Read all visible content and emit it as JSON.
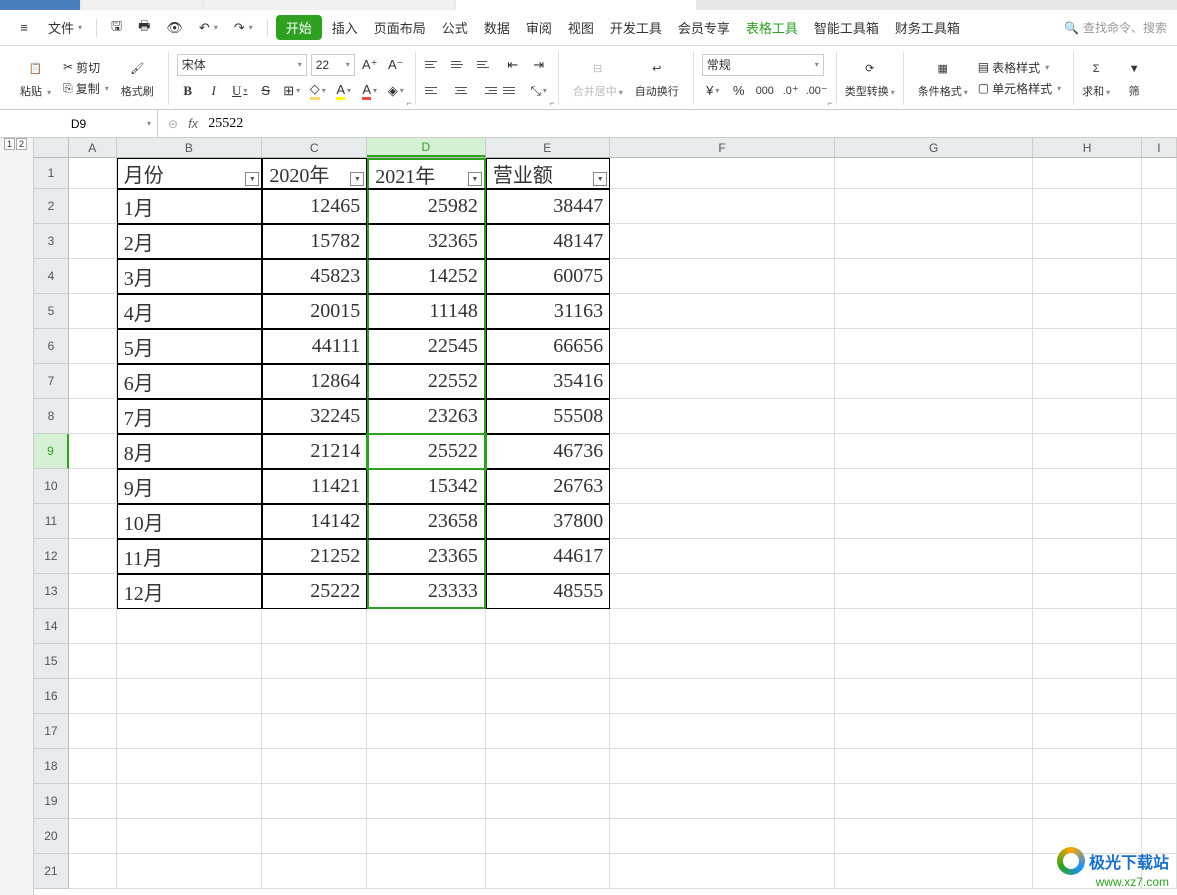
{
  "menu": {
    "file": "文件",
    "items": [
      "开始",
      "插入",
      "页面布局",
      "公式",
      "数据",
      "审阅",
      "视图",
      "开发工具",
      "会员专享",
      "表格工具",
      "智能工具箱",
      "财务工具箱"
    ],
    "search_placeholder": "查找命令、搜索"
  },
  "ribbon": {
    "paste": "粘贴",
    "cut": "剪切",
    "copy": "复制",
    "format_painter": "格式刷",
    "font_name": "宋体",
    "font_size": "22",
    "merge_center": "合并居中",
    "wrap_text": "自动换行",
    "number_format": "常规",
    "type_convert": "类型转换",
    "cond_format": "条件格式",
    "table_style": "表格样式",
    "cell_style": "单元格样式",
    "sum": "求和",
    "filter": "筛"
  },
  "formula_bar": {
    "cell_ref": "D9",
    "fx": "fx",
    "value": "25522"
  },
  "columns": [
    "A",
    "B",
    "C",
    "D",
    "E",
    "F",
    "G",
    "H",
    "I"
  ],
  "header_row": {
    "B": "月份",
    "C": "2020年",
    "D": "2021年",
    "E": "营业额"
  },
  "data": [
    {
      "B": "1月",
      "C": "12465",
      "D": "25982",
      "E": "38447"
    },
    {
      "B": "2月",
      "C": "15782",
      "D": "32365",
      "E": "48147"
    },
    {
      "B": "3月",
      "C": "45823",
      "D": "14252",
      "E": "60075"
    },
    {
      "B": "4月",
      "C": "20015",
      "D": "11148",
      "E": "31163"
    },
    {
      "B": "5月",
      "C": "44111",
      "D": "22545",
      "E": "66656"
    },
    {
      "B": "6月",
      "C": "12864",
      "D": "22552",
      "E": "35416"
    },
    {
      "B": "7月",
      "C": "32245",
      "D": "23263",
      "E": "55508"
    },
    {
      "B": "8月",
      "C": "21214",
      "D": "25522",
      "E": "46736"
    },
    {
      "B": "9月",
      "C": "11421",
      "D": "15342",
      "E": "26763"
    },
    {
      "B": "10月",
      "C": "14142",
      "D": "23658",
      "E": "37800"
    },
    {
      "B": "11月",
      "C": "21252",
      "D": "23365",
      "E": "44617"
    },
    {
      "B": "12月",
      "C": "25222",
      "D": "23333",
      "E": "48555"
    }
  ],
  "active": {
    "row": 9,
    "col": "D"
  },
  "watermark": {
    "line1": "极光下载站",
    "line2": "www.xz7.com"
  },
  "ruler": {
    "tabs": [
      "1",
      "2"
    ]
  }
}
